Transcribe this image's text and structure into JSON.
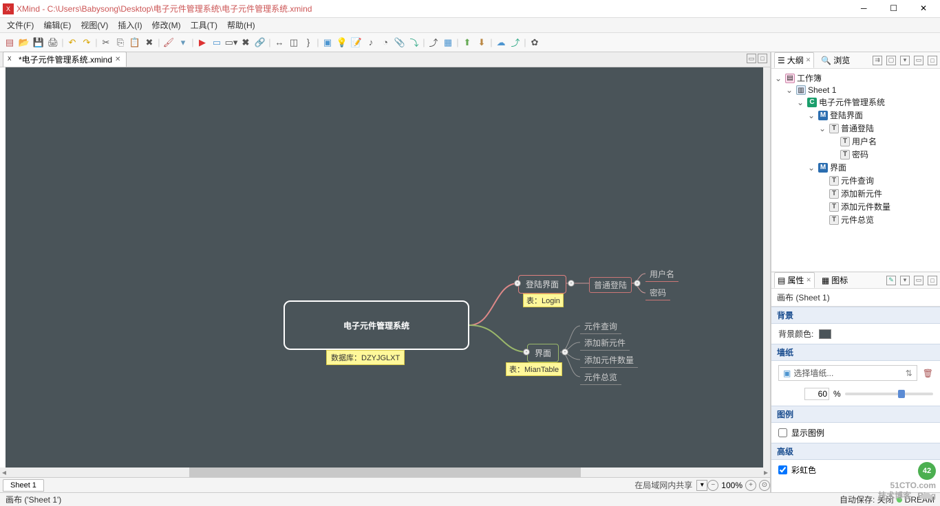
{
  "window": {
    "title": "XMind - C:\\Users\\Babysong\\Desktop\\电子元件管理系统\\电子元件管理系统.xmind"
  },
  "menu": {
    "file": "文件(F)",
    "edit": "编辑(E)",
    "view": "视图(V)",
    "insert": "插入(I)",
    "modify": "修改(M)",
    "tools": "工具(T)",
    "help": "帮助(H)"
  },
  "tab": {
    "label": "*电子元件管理系统.xmind"
  },
  "mindmap": {
    "root": "电子元件管理系统",
    "root_note": "数据库：DZYJGLXT",
    "login": "登陆界面",
    "login_note": "表：Login",
    "login_sub": "普通登陆",
    "login_leaf1": "用户名",
    "login_leaf2": "密码",
    "ui": "界面",
    "ui_note": "表：MianTable",
    "ui_leaf1": "元件查询",
    "ui_leaf2": "添加新元件",
    "ui_leaf3": "添加元件数量",
    "ui_leaf4": "元件总览"
  },
  "outline": {
    "tab1": "大纲",
    "tab2": "浏览",
    "workbook": "工作簿",
    "sheet": "Sheet 1",
    "n_root": "电子元件管理系统",
    "n_login": "登陆界面",
    "n_login_sub": "普通登陆",
    "n_login_l1": "用户名",
    "n_login_l2": "密码",
    "n_ui": "界面",
    "n_ui_l1": "元件查询",
    "n_ui_l2": "添加新元件",
    "n_ui_l3": "添加元件数量",
    "n_ui_l4": "元件总览"
  },
  "props": {
    "tab1": "属性",
    "tab2": "图标",
    "title": "画布 (Sheet 1)",
    "sec_bg": "背景",
    "bg_color_label": "背景颜色:",
    "sec_wallpaper": "墙纸",
    "wallpaper_pick": "选择墙纸...",
    "opacity_value": "60",
    "opacity_unit": "%",
    "sec_legend": "图例",
    "show_legend": "显示图例",
    "sec_advanced": "高级",
    "rainbow": "彩虹色"
  },
  "sheetbar": {
    "tab": "Sheet 1",
    "share": "在局域网内共享",
    "zoom": "100%"
  },
  "status": {
    "left": "画布 ('Sheet 1')",
    "autosave": "自动保存: 关闭",
    "right": "DREAM"
  },
  "watermark": {
    "l1": "51CTO.com",
    "l2": "技术博客",
    "l3": "Blog"
  }
}
